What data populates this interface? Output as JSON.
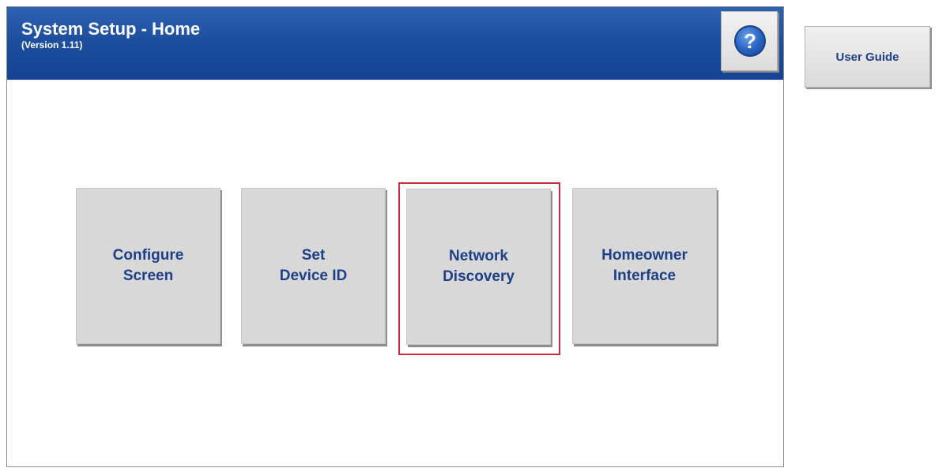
{
  "header": {
    "title": "System Setup - Home",
    "version": "(Version 1.11)",
    "help_icon": "question-mark-icon"
  },
  "tiles": [
    {
      "label": "Configure\nScreen"
    },
    {
      "label": "Set\nDevice ID"
    },
    {
      "label": "Network\nDiscovery",
      "selected": true
    },
    {
      "label": "Homeowner\nInterface"
    }
  ],
  "side": {
    "user_guide_label": "User Guide"
  },
  "colors": {
    "header_blue": "#1e4f9f",
    "tile_text": "#1d3f88",
    "tile_bg": "#d8d8d8",
    "selection": "#cf2a3c"
  }
}
